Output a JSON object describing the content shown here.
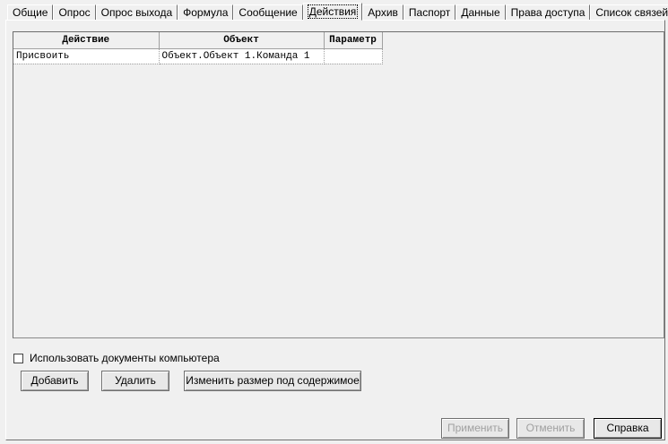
{
  "tabs": [
    {
      "label": "Общие"
    },
    {
      "label": "Опрос"
    },
    {
      "label": "Опрос выхода"
    },
    {
      "label": "Формула"
    },
    {
      "label": "Сообщение"
    },
    {
      "label": "Действия"
    },
    {
      "label": "Архив"
    },
    {
      "label": "Паспорт"
    },
    {
      "label": "Данные"
    },
    {
      "label": "Права доступа"
    },
    {
      "label": "Список связей"
    }
  ],
  "active_tab": "Действия",
  "table": {
    "columns": [
      "Действие",
      "Объект",
      "Параметр"
    ],
    "rows": [
      [
        "Присвоить",
        "Объект.Объект 1.Команда 1",
        ""
      ]
    ]
  },
  "use_computer_documents": {
    "label": "Использовать документы компьютера",
    "checked": false
  },
  "buttons": {
    "add": "Добавить",
    "delete": "Удалить",
    "autosize": "Изменить размер под содержимое",
    "apply": "Применить",
    "cancel": "Отменить",
    "help": "Справка"
  }
}
